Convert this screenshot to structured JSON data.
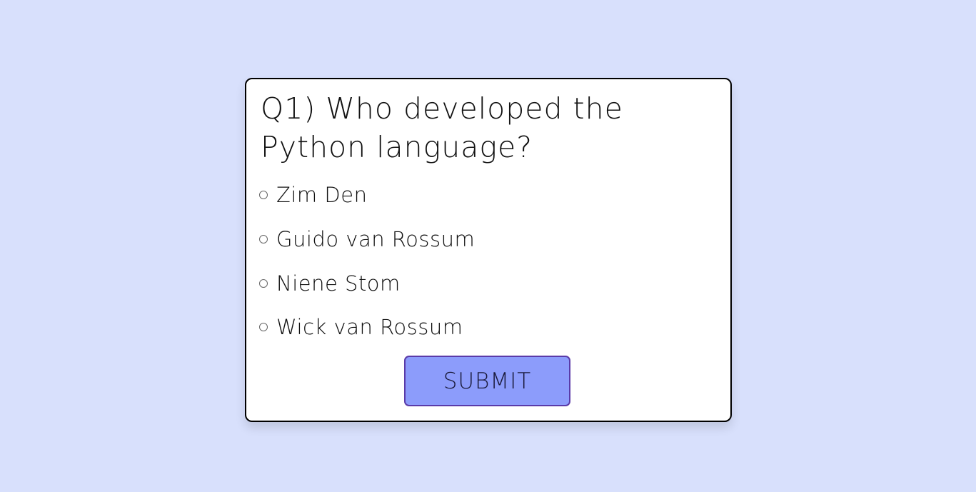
{
  "quiz": {
    "question": "Q1) Who developed the Python language?",
    "options": [
      "Zim Den",
      "Guido van Rossum",
      "Niene Stom",
      "Wick van Rossum"
    ],
    "submit_label": "SUBMIT"
  },
  "colors": {
    "background": "#d8e0fc",
    "button": "#8c9cfb",
    "button_border": "#5a3aa8"
  }
}
